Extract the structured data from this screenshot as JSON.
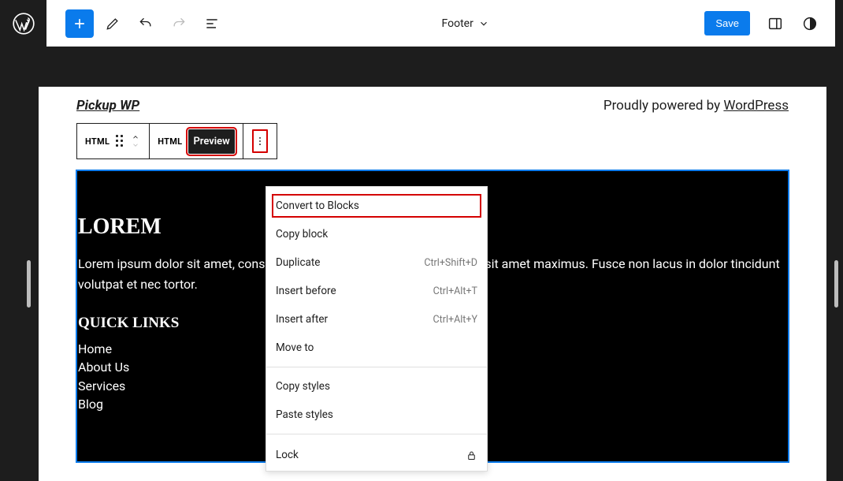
{
  "topbar": {
    "document_label": "Footer",
    "save_label": "Save"
  },
  "site": {
    "title": "Pickup WP",
    "powered_prefix": "Proudly powered by ",
    "powered_link": "WordPress"
  },
  "toolbar": {
    "block_type": "HTML",
    "tab_html": "HTML",
    "tab_preview": "Preview"
  },
  "block": {
    "heading": "LOREM",
    "paragraph": "Lorem ipsum dolor sit amet, consectetur adipiscing elit. Ut commodo mi sit amet maximus. Fusce non lacus in dolor tincidunt volutpat et nec tortor.",
    "quick_heading": "QUICK LINKS",
    "links": [
      "Home",
      "About Us",
      "Services",
      "Blog"
    ]
  },
  "menu": {
    "items": [
      {
        "label": "Convert to Blocks",
        "kbd": ""
      },
      {
        "label": "Copy block",
        "kbd": ""
      },
      {
        "label": "Duplicate",
        "kbd": "Ctrl+Shift+D"
      },
      {
        "label": "Insert before",
        "kbd": "Ctrl+Alt+T"
      },
      {
        "label": "Insert after",
        "kbd": "Ctrl+Alt+Y"
      },
      {
        "label": "Move to",
        "kbd": ""
      }
    ],
    "group2": [
      {
        "label": "Copy styles"
      },
      {
        "label": "Paste styles"
      }
    ],
    "lock": "Lock"
  }
}
